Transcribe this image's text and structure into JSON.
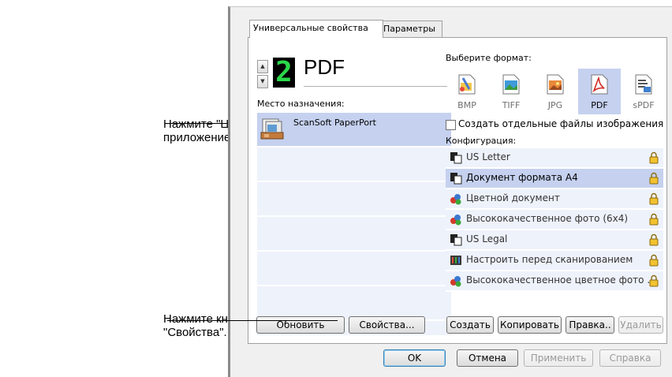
{
  "annotations": {
    "target_app_line1": "Нажмите \"Целевое",
    "target_app_line2": "приложение\".",
    "properties_line1": "Нажмите кнопку",
    "properties_line2": "\"Свойства\"."
  },
  "tabs": [
    {
      "label": "Универсальные свойства",
      "active": true
    },
    {
      "label": "Параметры",
      "active": false
    }
  ],
  "left": {
    "counter": "2",
    "format": "PDF",
    "destination_label": "Место назначения:",
    "destinations": [
      {
        "label": "ScanSoft PaperPort",
        "selected": true
      }
    ],
    "refresh_button": "Обновить",
    "properties_button": "Свойства..."
  },
  "right": {
    "choose_format_label": "Выберите формат:",
    "formats": [
      {
        "name": "BMP",
        "icon": "bmp-file-icon",
        "selected": false
      },
      {
        "name": "TIFF",
        "icon": "tiff-file-icon",
        "selected": false
      },
      {
        "name": "JPG",
        "icon": "jpg-file-icon",
        "selected": false
      },
      {
        "name": "PDF",
        "icon": "pdf-file-icon",
        "selected": true
      },
      {
        "name": "sPDF",
        "icon": "spdf-file-icon",
        "selected": false
      }
    ],
    "separate_files_checkbox": "Создать отдельные файлы изображения",
    "config_label": "Конфигурация:",
    "configs": [
      {
        "label": "US Letter",
        "icon": "bw-document-icon",
        "selected": false
      },
      {
        "label": "Документ формата A4",
        "icon": "bw-document-icon",
        "selected": true
      },
      {
        "label": "Цветной документ",
        "icon": "color-document-icon",
        "selected": false
      },
      {
        "label": "Высококачественное фото (6x4)",
        "icon": "color-document-icon",
        "selected": false
      },
      {
        "label": "US Legal",
        "icon": "bw-document-icon",
        "selected": false
      },
      {
        "label": "Настроить перед сканированием",
        "icon": "configure-icon",
        "selected": false
      },
      {
        "label": "Высококачественное цветное фото ...",
        "icon": "color-document-icon",
        "selected": false
      }
    ],
    "create_button": "Создать",
    "copy_button": "Копировать",
    "edit_button": "Правка..",
    "delete_button": "Удалить"
  },
  "footer": {
    "ok": "OK",
    "cancel": "Отмена",
    "apply": "Применить",
    "help": "Справка"
  },
  "colors": {
    "selection": "#c5d1ef",
    "list_bg": "#eef2fb",
    "digit": "#2bd84a",
    "dialog_bg": "#f0f0f0"
  }
}
